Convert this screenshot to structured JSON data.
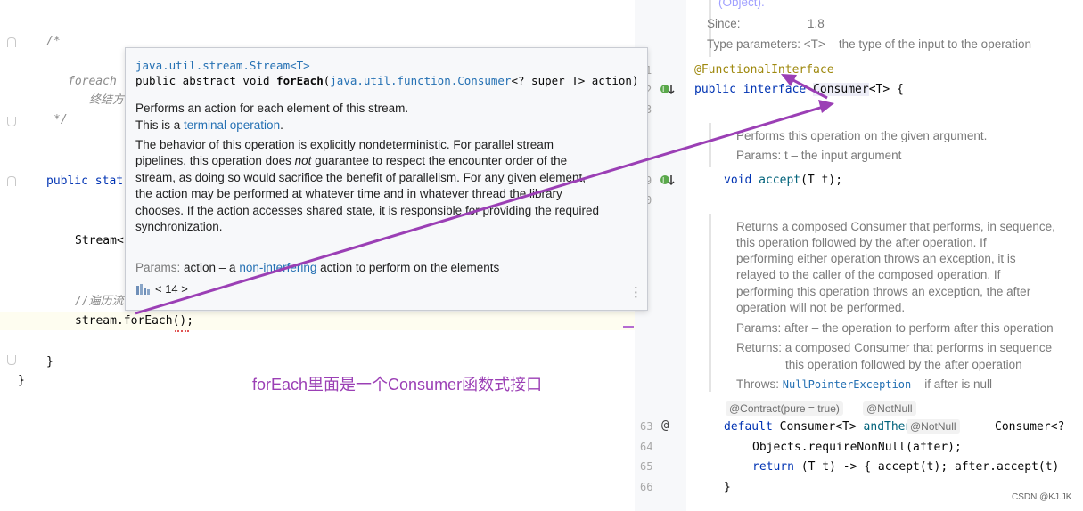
{
  "left_editor": {
    "comment_open": "/*",
    "comment_line1": "foreach",
    "comment_line2": "终结方",
    "comment_close": "*/",
    "method_decl": "public stat",
    "stream_decl": "Stream<",
    "iter_comment": "//遍历流",
    "call_line": "stream.forEach();",
    "close_brace_inner": "}",
    "close_brace_outer": "}"
  },
  "popup": {
    "class_name": "java.util.stream.Stream<T>",
    "signature_prefix": "public abstract void ",
    "method_name": "forEach",
    "param_type": "java.util.function.Consumer",
    "signature_suffix": "<? super T> action)",
    "desc_line1": "Performs an action for each element of this stream.",
    "desc_line2_prefix": "This is a ",
    "desc_line2_link": "terminal operation",
    "desc_line2_suffix": ".",
    "para_1": "The behavior of this operation is explicitly nondeterministic. For parallel stream",
    "para_2_a": "pipelines, this operation does ",
    "para_2_em": "not",
    "para_2_b": " guarantee to respect the encounter order of the",
    "para_3": "stream, as doing so would sacrifice the benefit of parallelism. For any given element,",
    "para_4": "the action may be performed at whatever time and in whatever thread the library",
    "para_5": "chooses. If the action accesses shared state, it is responsible for providing the required",
    "para_6": "synchronization.",
    "params_label": "Params:",
    "params_a": " action – a ",
    "params_link": "non-interfering",
    "params_b": " action to perform on the elements",
    "nav_text": "< 14 >",
    "more_icon": "⋮"
  },
  "right_pane": {
    "top_cut": "(Object).",
    "since_label": "Since:",
    "since_value": "1.8",
    "type_params": "Type parameters: <T> – the type of the input to the operation",
    "gutter_nums": [
      "1",
      "2",
      "3",
      "9",
      "0",
      "63",
      "64",
      "65",
      "66"
    ],
    "annotation_line": "@FunctionalInterface",
    "interface_kw": "public interface ",
    "interface_name": "Consumer",
    "interface_tail": "<T> {",
    "accept_doc1": "Performs this operation on the given argument.",
    "accept_doc2": "Params: t – the input argument",
    "accept_kw": "void ",
    "accept_name": "accept",
    "accept_tail": "(T t);",
    "andthen_doc": [
      "Returns a composed Consumer that performs, in sequence,",
      "this operation followed by the after operation. If",
      "performing either operation throws an exception, it is",
      "relayed to the caller of the composed operation. If",
      "performing this operation throws an exception, the after",
      "operation will not be performed."
    ],
    "andthen_params": "Params: after – the operation to perform after this operation",
    "andthen_returns1": "Returns: a composed Consumer that performs in sequence",
    "andthen_returns2": "this operation followed by the after operation",
    "andthen_throws_label": "Throws: ",
    "andthen_throws_link": "NullPointerException",
    "andthen_throws_tail": " – if after is null",
    "chip_contract": "@Contract(pure = true)",
    "chip_notnull": "@NotNull",
    "default_kw": "default ",
    "default_type": "Consumer<T> ",
    "default_name": "andThen",
    "default_open": "( ",
    "default_param_type": "Consumer<?",
    "line64": "Objects.requireNonNull(after);",
    "line65_kw": "return ",
    "line65_rest": "(T t) -> { accept(t); after.accept(t)",
    "line66": "}"
  },
  "annotation_label": "forEach里面是一个Consumer函数式接口",
  "watermark": "CSDN @KJ.JK",
  "colors": {
    "annotation": "#9b3fb5",
    "keyword": "#0033b3",
    "link": "#2470b3",
    "java_annotation": "#9e880d"
  }
}
